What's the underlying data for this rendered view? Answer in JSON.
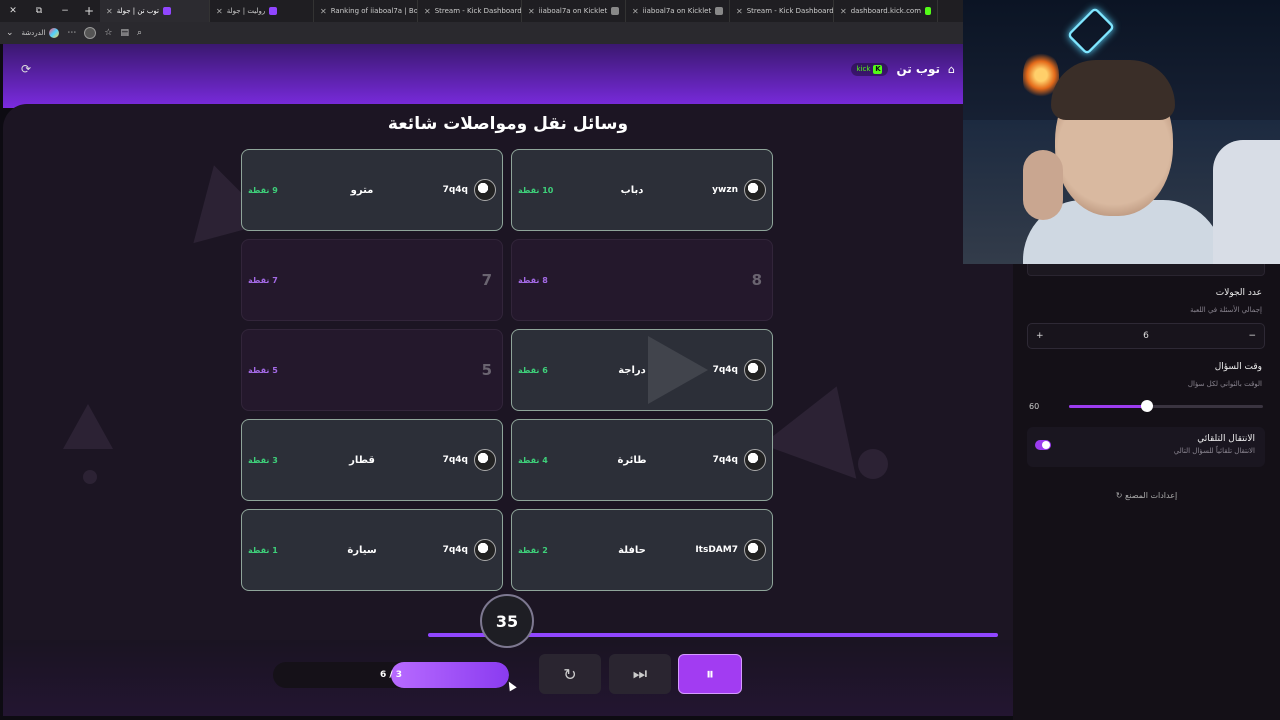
{
  "browser": {
    "tabs": [
      {
        "label": "توب تن | جولة",
        "icon": "purple",
        "active": true
      },
      {
        "label": "روليت | جولة",
        "icon": "purple",
        "active": false
      },
      {
        "label": "Ranking of iiaboal7a | Bot",
        "icon": "white",
        "active": false
      },
      {
        "label": "Stream - Kick Dashboard",
        "icon": "kick",
        "active": false
      },
      {
        "label": "iiaboal7a on Kicklet",
        "icon": "gray",
        "active": false
      },
      {
        "label": "iiaboal7a on Kicklet",
        "icon": "gray",
        "active": false
      },
      {
        "label": "Stream - Kick Dashboard",
        "icon": "kick",
        "active": false
      },
      {
        "label": "dashboard.kick.com",
        "icon": "kick",
        "active": false
      }
    ],
    "chat_label": "الدردشة"
  },
  "header": {
    "title": "توب تن",
    "kick_label": "kick"
  },
  "question": "وسائل نقل ومواصلات شائعة",
  "slots": [
    {
      "rank": "10",
      "revealed": true,
      "player": "ywzn",
      "answer": "دباب",
      "points": "10 نقطة"
    },
    {
      "rank": "9",
      "revealed": true,
      "player": "7q4q",
      "answer": "مترو",
      "points": "9 نقطة"
    },
    {
      "rank": "8",
      "revealed": false,
      "player": "",
      "answer": "",
      "points": "8 نقطة"
    },
    {
      "rank": "7",
      "revealed": false,
      "player": "",
      "answer": "",
      "points": "7 نقطة"
    },
    {
      "rank": "6",
      "revealed": true,
      "player": "7q4q",
      "answer": "دراجة",
      "points": "6 نقطة"
    },
    {
      "rank": "5",
      "revealed": false,
      "player": "",
      "answer": "",
      "points": "5 نقطة"
    },
    {
      "rank": "4",
      "revealed": true,
      "player": "7q4q",
      "answer": "طائرة",
      "points": "4 نقطة"
    },
    {
      "rank": "3",
      "revealed": true,
      "player": "7q4q",
      "answer": "قطار",
      "points": "3 نقطة"
    },
    {
      "rank": "2",
      "revealed": true,
      "player": "ItsDAM7",
      "answer": "حافلة",
      "points": "2 نقطة"
    },
    {
      "rank": "1",
      "revealed": true,
      "player": "7q4q",
      "answer": "سيارة",
      "points": "1 نقطة"
    }
  ],
  "timer": {
    "value": "35"
  },
  "progress": {
    "label": "6 / 3",
    "current": 3,
    "total": 6
  },
  "settings": {
    "rounds_label": "عدد الجولات",
    "rounds_sub": "إجمالي الأسئلة في اللعبة",
    "rounds_value": "6",
    "rounds_plus": "+",
    "rounds_minus": "−",
    "time_label": "وقت السؤال",
    "time_sub": "الوقت بالثواني لكل سؤال",
    "time_value": "60",
    "time_fraction": 0.4,
    "auto_label": "الانتقال التلقائي",
    "auto_sub": "الانتقال تلقائياً للسؤال التالي",
    "auto_on": true,
    "factory_label": "إعدادات المصنع"
  },
  "colors": {
    "accent": "#9c3cf0",
    "kick": "#53fc18",
    "points_revealed": "#3ed07a",
    "points_hidden": "#a46ae6"
  },
  "icons": {
    "home": "home-icon",
    "refresh": "refresh-icon",
    "reset": "reset-icon",
    "skip": "skip-icon",
    "pause": "pause-icon"
  }
}
